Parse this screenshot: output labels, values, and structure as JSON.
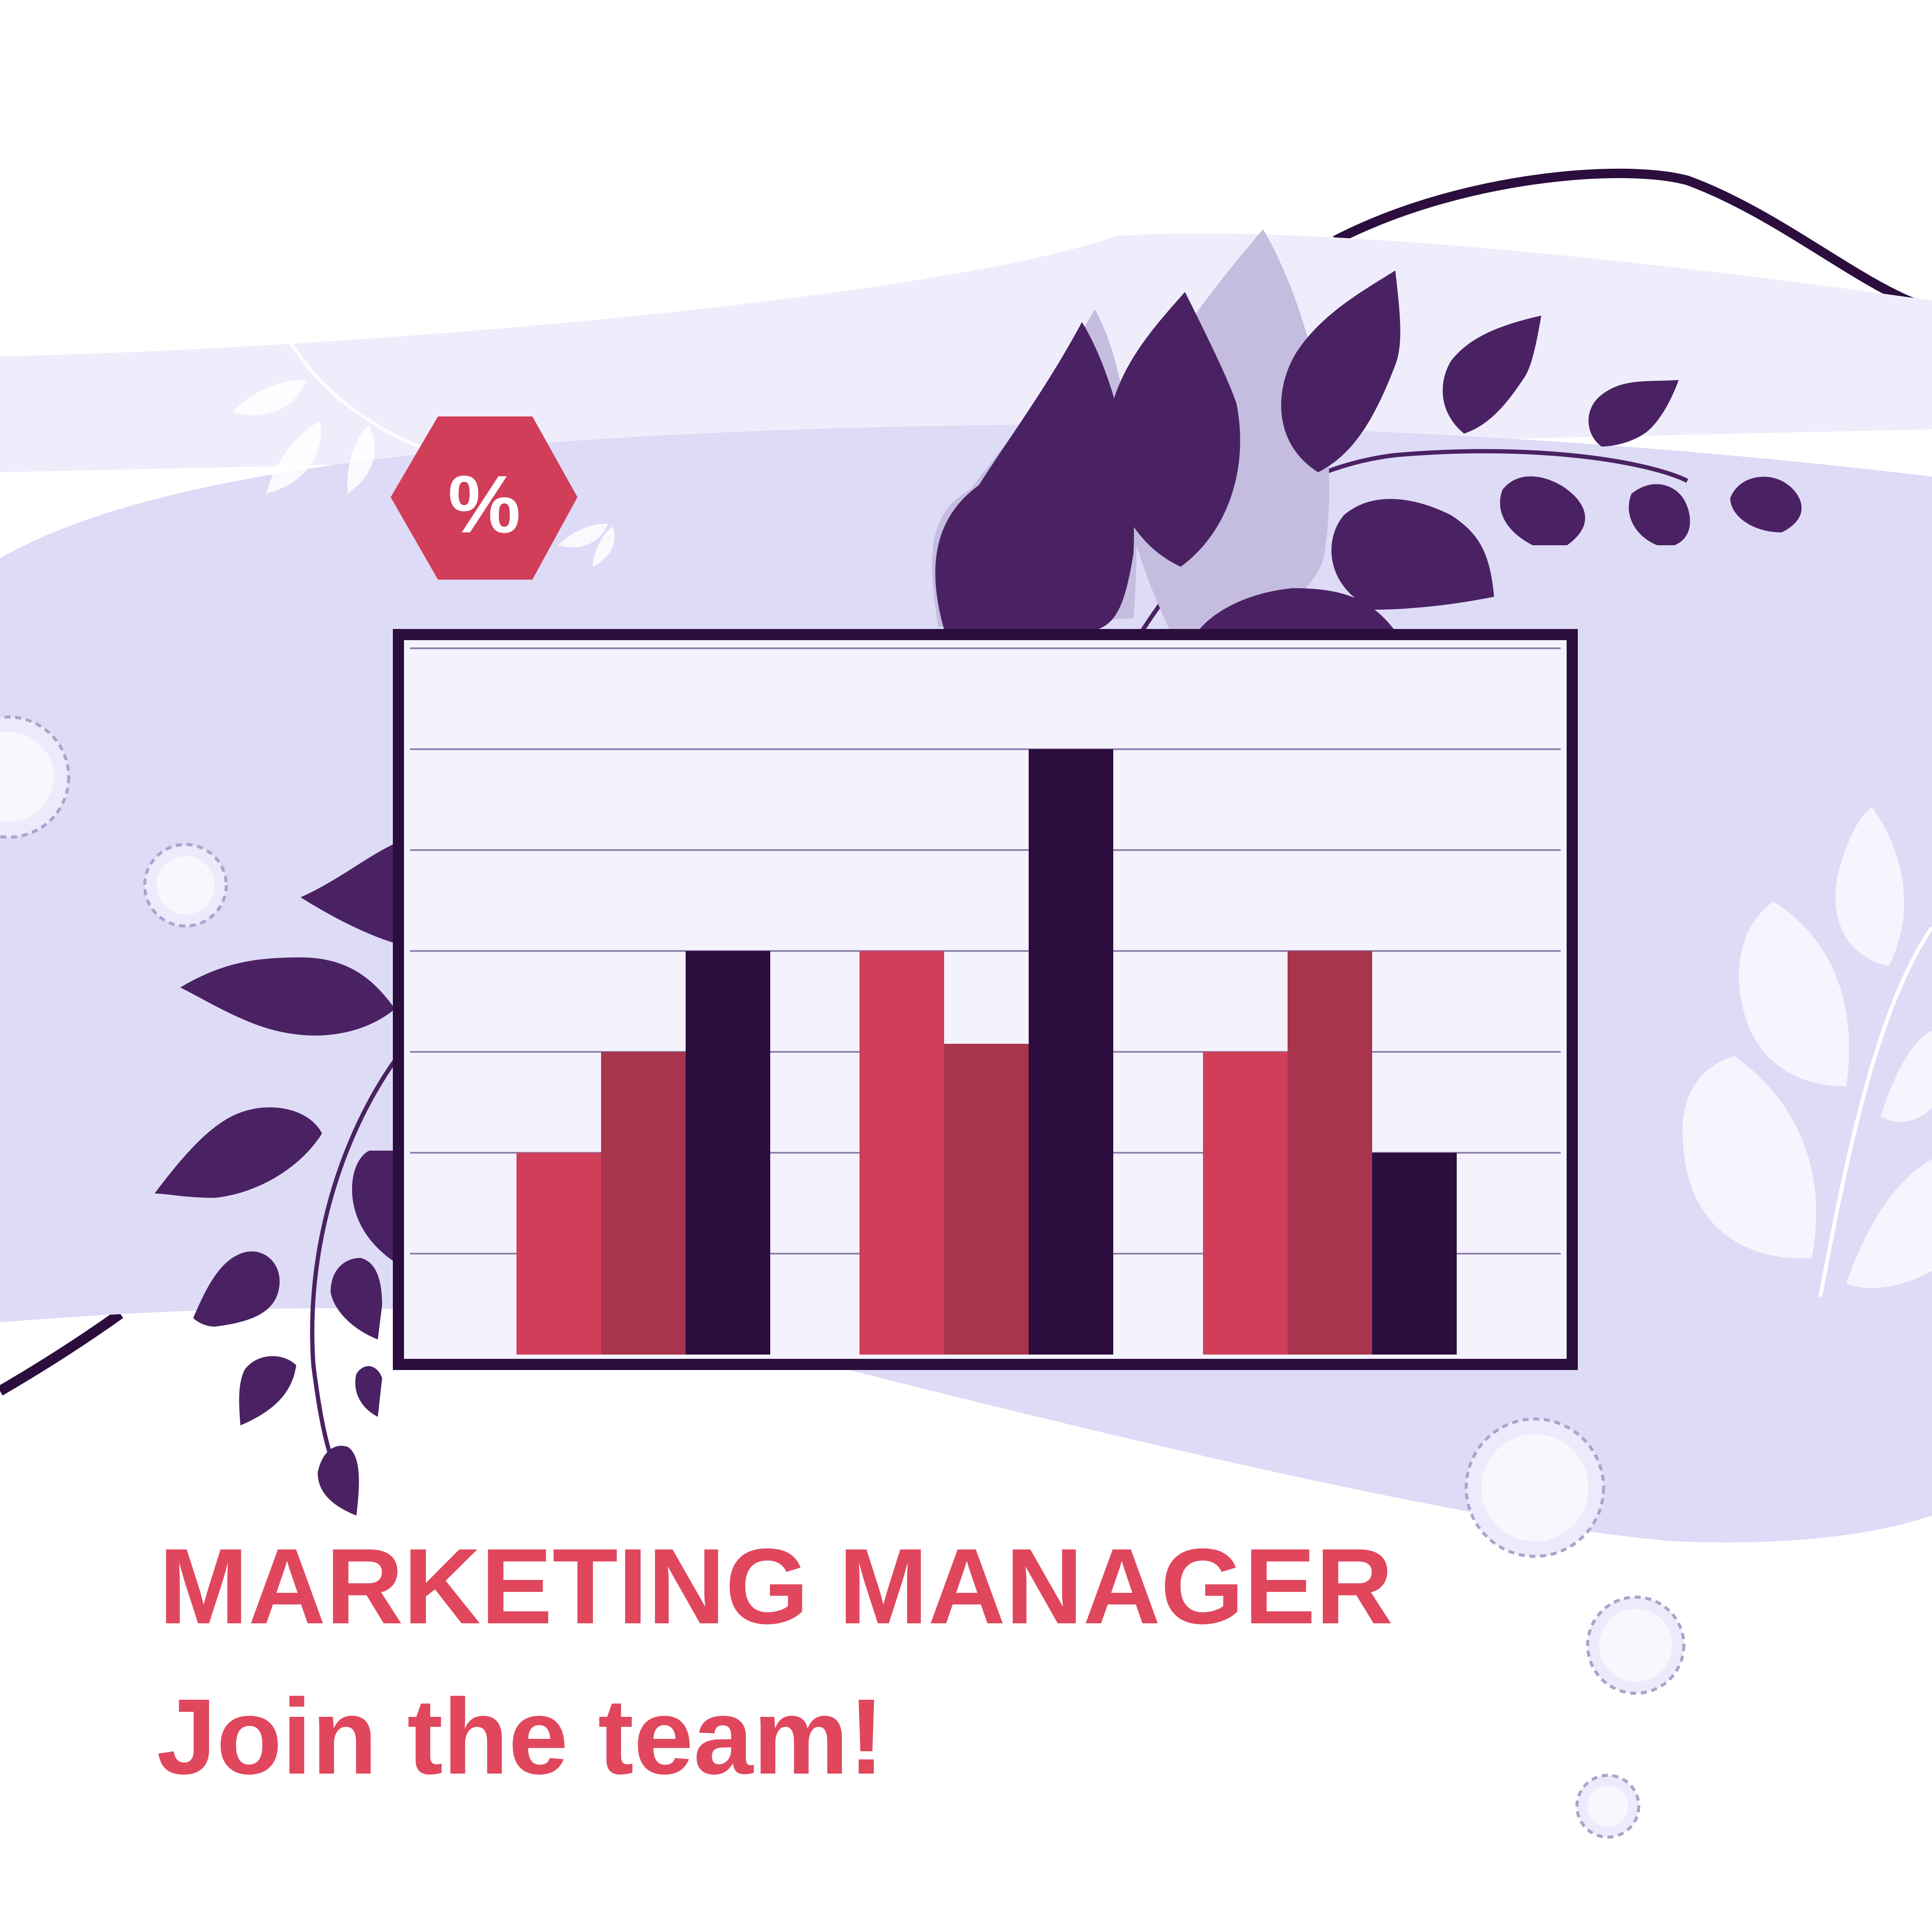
{
  "badge": {
    "symbol": "%",
    "color": "#d13e59",
    "icon": "percent-hexagon-icon"
  },
  "headline": "MARKETING MANAGER",
  "subline": "Join the team!",
  "colors": {
    "text_accent": "#e0475d",
    "bar_pink": "#d13e59",
    "bar_maroon": "#a8344d",
    "bar_dark": "#2b0e3d",
    "leaf_purple": "#4a2263",
    "leaf_shadow": "#c4bde0",
    "band_light": "#efedfb",
    "band_mid": "#dedbf7",
    "panel_bg": "#f4f2fd",
    "frame": "#2b0e3d"
  },
  "chart_data": {
    "type": "bar",
    "ylim": [
      0,
      7
    ],
    "grid": true,
    "groups": [
      {
        "values": [
          2,
          3,
          4
        ]
      },
      {
        "values": [
          4,
          3.08,
          6
        ]
      },
      {
        "values": [
          3,
          4,
          2
        ]
      }
    ]
  }
}
